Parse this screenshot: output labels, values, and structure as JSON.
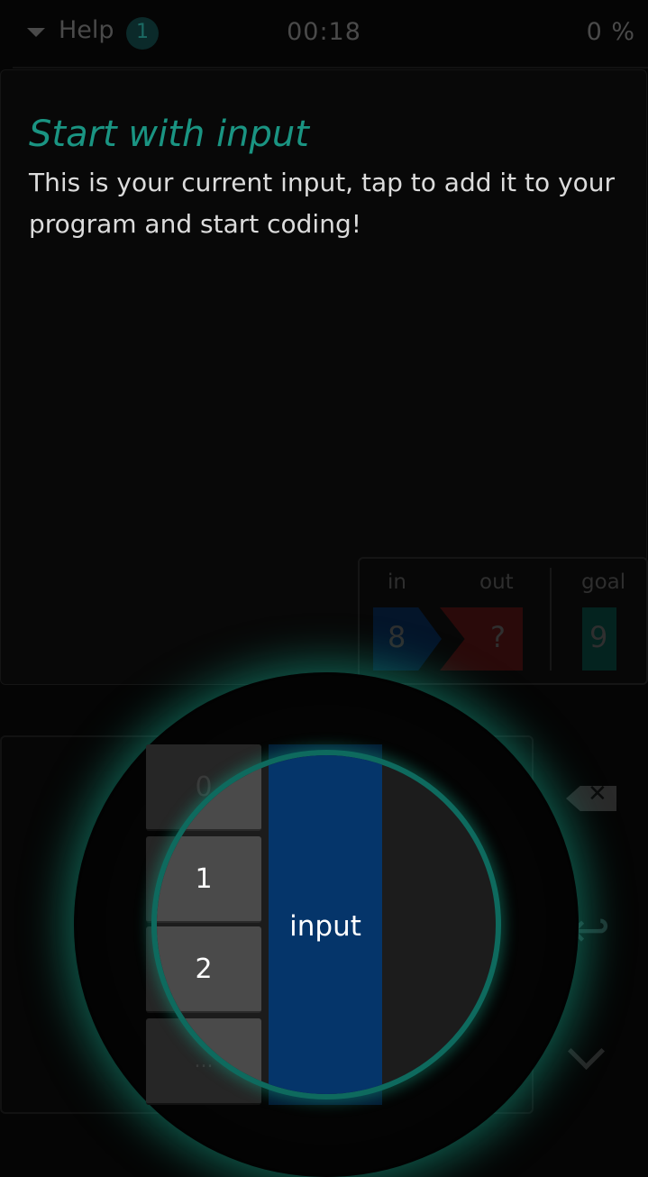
{
  "topbar": {
    "help_label": "Help",
    "help_badge": "1",
    "timer": "00:18",
    "progress": "0 %"
  },
  "help": {
    "title": "Start with input",
    "text": "This is your current input, tap to add it to your program and start coding!"
  },
  "io": {
    "in_label": "in",
    "out_label": "out",
    "goal_label": "goal",
    "in_value": "8",
    "out_value": "?",
    "goal_value": "9"
  },
  "keypad": {
    "keys": [
      "0",
      "1",
      "2",
      "..."
    ],
    "input_label": "input"
  },
  "side_controls": {
    "delete_glyph": "✕"
  },
  "colors": {
    "accent": "#1a9482",
    "input_blue": "#05356a",
    "glow": "#15a68a"
  }
}
